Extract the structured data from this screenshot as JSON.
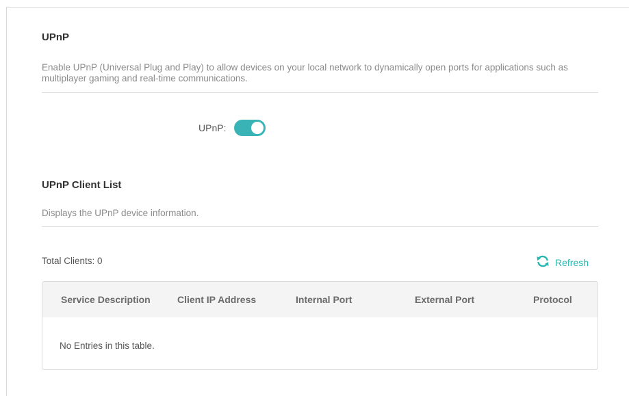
{
  "colors": {
    "accent": "#29b6b0",
    "toggle_on": "#39b3b5"
  },
  "upnp_section": {
    "title": "UPnP",
    "description": "Enable UPnP (Universal Plug and Play) to allow devices on your local network to dynamically open ports for applications such as multiplayer gaming and real-time communications.",
    "toggle_label": "UPnP:",
    "toggle_state": "on"
  },
  "client_list": {
    "title": "UPnP Client List",
    "description": "Displays the UPnP device information.",
    "total_clients_label": "Total Clients: 0",
    "refresh_label": "Refresh",
    "refresh_icon": "refresh-icon",
    "table": {
      "columns": [
        "Service Description",
        "Client IP Address",
        "Internal Port",
        "External Port",
        "Protocol"
      ],
      "empty_message": "No Entries in this table."
    }
  }
}
